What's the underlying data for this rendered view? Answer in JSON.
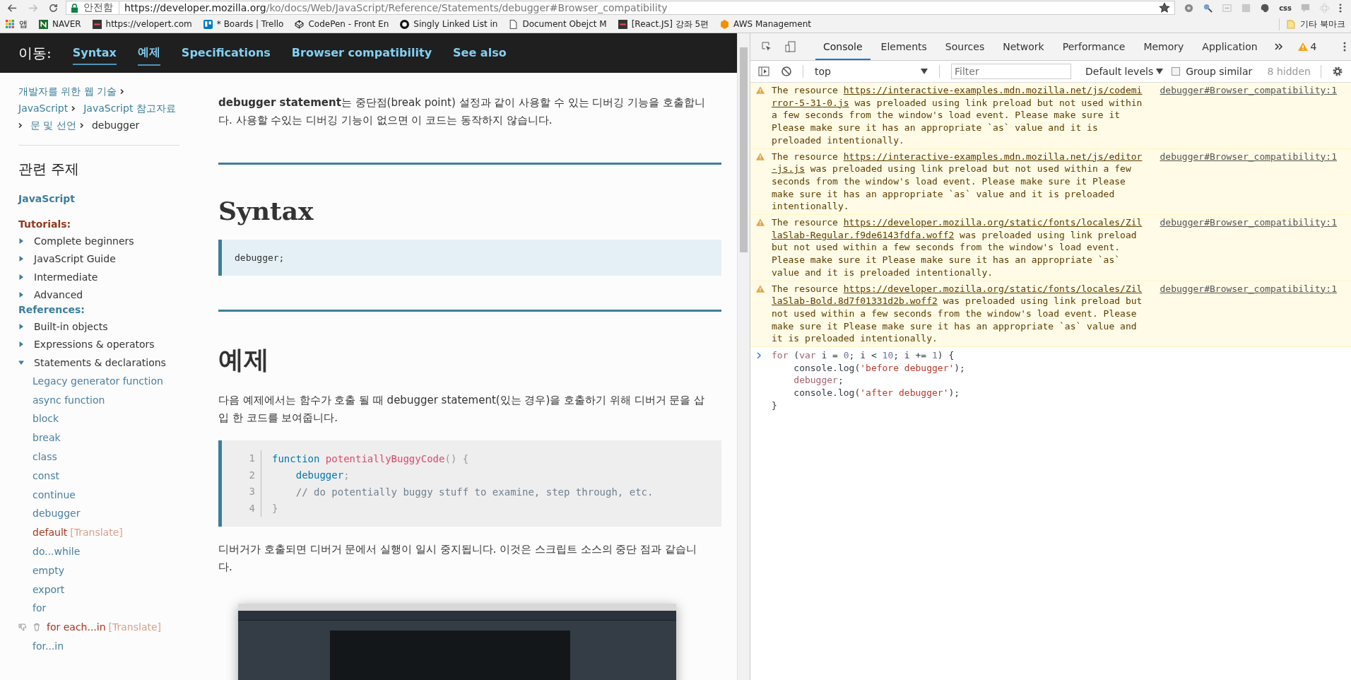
{
  "browser": {
    "security_label": "안전함",
    "url_host": "https://developer.mozilla.org",
    "url_path": "/ko/docs/Web/JavaScript/Reference/Statements/debugger#Browser_compatibility",
    "bookmarked": true,
    "extension_text": "css",
    "bookmarks": [
      {
        "label": "앱",
        "kind": "apps"
      },
      {
        "label": "NAVER",
        "kind": "naver"
      },
      {
        "label": "https://velopert.com",
        "kind": "site"
      },
      {
        "label": "* Boards | Trello",
        "kind": "trello"
      },
      {
        "label": "CodePen - Front En",
        "kind": "codepen"
      },
      {
        "label": "Singly Linked List in",
        "kind": "github"
      },
      {
        "label": "Document Obejct M",
        "kind": "page"
      },
      {
        "label": "[React.JS] 강좌 5편",
        "kind": "site"
      },
      {
        "label": "AWS Management",
        "kind": "aws"
      }
    ],
    "other_bookmarks": "기타 북마크"
  },
  "page_nav": {
    "label": "이동:",
    "links": [
      {
        "label": "Syntax",
        "active": true
      },
      {
        "label": "예제",
        "active": true
      },
      {
        "label": "Specifications",
        "active": false
      },
      {
        "label": "Browser compatibility",
        "active": false
      },
      {
        "label": "See also",
        "active": false
      }
    ]
  },
  "sidebar": {
    "breadcrumbs": [
      {
        "label": "개발자를 위한 웹 기술",
        "link": true
      },
      {
        "label": "JavaScript",
        "link": true
      },
      {
        "label": "JavaScript 참고자료",
        "link": true
      },
      {
        "label": "문 및 선언",
        "link": true
      },
      {
        "label": "debugger",
        "link": false
      }
    ],
    "related_title": "관련 주제",
    "top_link": "JavaScript",
    "sections": [
      {
        "title": "Tutorials:",
        "kind": "tutorials",
        "items": [
          {
            "label": "Complete beginners",
            "expanded": false
          },
          {
            "label": "JavaScript Guide",
            "expanded": false
          },
          {
            "label": "Intermediate",
            "expanded": false
          },
          {
            "label": "Advanced",
            "expanded": false
          }
        ]
      },
      {
        "title": "References:",
        "kind": "references",
        "items": [
          {
            "label": "Built-in objects",
            "expanded": false
          },
          {
            "label": "Expressions & operators",
            "expanded": false
          },
          {
            "label": "Statements & declarations",
            "expanded": true,
            "children": [
              {
                "label": "Legacy generator function",
                "kind": "link"
              },
              {
                "label": "async function",
                "kind": "link"
              },
              {
                "label": "block",
                "kind": "link"
              },
              {
                "label": "break",
                "kind": "link"
              },
              {
                "label": "class",
                "kind": "link"
              },
              {
                "label": "const",
                "kind": "link"
              },
              {
                "label": "continue",
                "kind": "link"
              },
              {
                "label": "debugger",
                "kind": "link"
              },
              {
                "label": "default",
                "kind": "untranslated",
                "tag": "[Translate]"
              },
              {
                "label": "do...while",
                "kind": "link"
              },
              {
                "label": "empty",
                "kind": "link"
              },
              {
                "label": "export",
                "kind": "link"
              },
              {
                "label": "for",
                "kind": "link"
              },
              {
                "label": "for each...in",
                "kind": "deprecated",
                "tag": "[Translate]"
              },
              {
                "label": "for...in",
                "kind": "link"
              }
            ]
          }
        ]
      }
    ]
  },
  "content": {
    "blocks": [
      {
        "kind": "paragraph",
        "text": "**debugger statement**는 중단점(break point) 설정과 같이 사용할 수 있는 디버깅 기능을 호출합니다. 사용할 수있는 디버깅 기능이 없으면 이 코드는 동작하지 않습니다."
      },
      {
        "kind": "rule"
      },
      {
        "kind": "heading",
        "text": "Syntax"
      },
      {
        "kind": "syntax",
        "text": "debugger;"
      },
      {
        "kind": "rule"
      },
      {
        "kind": "heading",
        "text": "예제"
      },
      {
        "kind": "paragraph",
        "text": "다음 예제에서는 함수가 호출 될 때 debugger statement(있는 경우)을 호출하기 위해 디버거 문을 삽입 한 코드를 보여줍니다."
      },
      {
        "kind": "code",
        "lines": [
          {
            "number": "1",
            "tokens": [
              {
                "t": "function",
                "kind": "keyword"
              },
              {
                "t": " potentiallyBuggyCode",
                "kind": "function"
              },
              {
                "t": "() {",
                "kind": "punct"
              }
            ]
          },
          {
            "number": "2",
            "tokens": [
              {
                "t": "    debugger",
                "kind": "keyword"
              },
              {
                "t": ";",
                "kind": "punct"
              }
            ]
          },
          {
            "number": "3",
            "tokens": [
              {
                "t": "    // do potentially buggy stuff to examine, step through, etc.",
                "kind": "comment"
              }
            ]
          },
          {
            "number": "4",
            "tokens": [
              {
                "t": "}",
                "kind": "punct"
              }
            ]
          }
        ]
      },
      {
        "kind": "paragraph",
        "text": "디버거가 호출되면 디버거 문에서 실행이 일시 중지됩니다. 이것은 스크립트 소스의 중단 점과 같습니다."
      },
      {
        "kind": "image"
      }
    ]
  },
  "devtools": {
    "tabs": [
      {
        "label": "Console",
        "selected": true
      },
      {
        "label": "Elements",
        "selected": false
      },
      {
        "label": "Sources",
        "selected": false
      },
      {
        "label": "Network",
        "selected": false
      },
      {
        "label": "Performance",
        "selected": false
      },
      {
        "label": "Memory",
        "selected": false
      },
      {
        "label": "Application",
        "selected": false
      }
    ],
    "warning_count": "4",
    "context": "top",
    "filter_placeholder": "Filter",
    "levels": "Default levels",
    "group_similar": {
      "label": "Group similar",
      "checked": false
    },
    "hidden_count": "8 hidden",
    "messages": [
      {
        "kind": "warning",
        "prefix": "The resource ",
        "url": "https://interactive-examples.mdn.mozilla.net/js/codemirror-5-31-0.js",
        "text": " was preloaded using link preload but not used within a few seconds from the window's load event. Please make sure it Please make sure it has an appropriate `as` value and it is preloaded intentionally.",
        "source": "debugger#Browser_compatibility:1"
      },
      {
        "kind": "warning",
        "prefix": "The resource ",
        "url": "https://interactive-examples.mdn.mozilla.net/js/editor-js.js",
        "text": " was preloaded using link preload but not used within a few seconds from the window's load event. Please make sure it Please make sure it has an appropriate `as` value and it is preloaded intentionally.",
        "source": "debugger#Browser_compatibility:1"
      },
      {
        "kind": "warning",
        "prefix": "The resource ",
        "url": "https://developer.mozilla.org/static/fonts/locales/ZillaSlab-Regular.f9de6143fdfa.woff2",
        "text": " was preloaded using link preload but not used within a few seconds from the window's load event. Please make sure it Please make sure it has an appropriate `as` value and it is preloaded intentionally.",
        "source": "debugger#Browser_compatibility:1"
      },
      {
        "kind": "warning",
        "prefix": "The resource ",
        "url": "https://developer.mozilla.org/static/fonts/locales/ZillaSlab-Bold.8d7f01331d2b.woff2",
        "text": " was preloaded using link preload but not used within a few seconds from the window's load event. Please make sure it Please make sure it has an appropriate `as` value and it is preloaded intentionally.",
        "source": "debugger#Browser_compatibility:1"
      }
    ],
    "input_lines": [
      [
        {
          "t": "for",
          "kind": "keyword"
        },
        {
          "t": " (",
          "kind": "plain"
        },
        {
          "t": "var",
          "kind": "keyword"
        },
        {
          "t": " i = ",
          "kind": "plain"
        },
        {
          "t": "0",
          "kind": "number"
        },
        {
          "t": "; i < ",
          "kind": "plain"
        },
        {
          "t": "10",
          "kind": "number"
        },
        {
          "t": "; i += ",
          "kind": "plain"
        },
        {
          "t": "1",
          "kind": "number"
        },
        {
          "t": ") {",
          "kind": "plain"
        }
      ],
      [
        {
          "t": "    console.log(",
          "kind": "plain"
        },
        {
          "t": "'before debugger'",
          "kind": "string"
        },
        {
          "t": ");",
          "kind": "plain"
        }
      ],
      [
        {
          "t": "    debugger",
          "kind": "keyword"
        },
        {
          "t": ";",
          "kind": "plain"
        }
      ],
      [
        {
          "t": "    console.log(",
          "kind": "plain"
        },
        {
          "t": "'after debugger'",
          "kind": "string"
        },
        {
          "t": ");",
          "kind": "plain"
        }
      ],
      [
        {
          "t": "}",
          "kind": "plain"
        }
      ]
    ]
  }
}
